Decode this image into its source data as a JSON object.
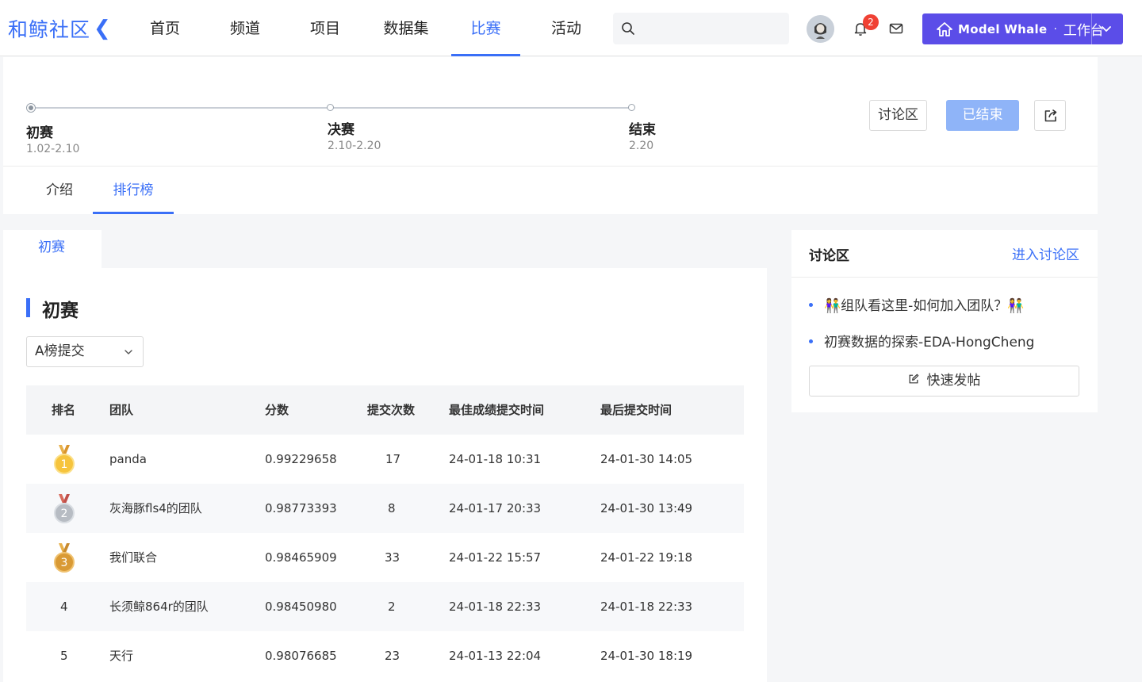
{
  "header": {
    "logo_text": "和鲸社区",
    "nav": [
      "首页",
      "频道",
      "项目",
      "数据集",
      "比赛",
      "活动"
    ],
    "active_nav": "比赛",
    "notification_count": "2",
    "workbench": {
      "brand": "Model Whale",
      "dot": "·",
      "label": "工作台"
    }
  },
  "stages": [
    {
      "name": "初赛",
      "date": "1.02-2.10"
    },
    {
      "name": "决赛",
      "date": "2.10-2.20"
    },
    {
      "name": "结束",
      "date": "2.20"
    }
  ],
  "actions": {
    "discuss": "讨论区",
    "ended": "已结束"
  },
  "subtabs": [
    "介绍",
    "排行榜"
  ],
  "active_subtab": "排行榜",
  "round_tab": "初赛",
  "section_title": "初赛",
  "select_value": "A榜提交",
  "table": {
    "headers": [
      "排名",
      "团队",
      "分数",
      "提交次数",
      "最佳成绩提交时间",
      "最后提交时间"
    ],
    "rows": [
      {
        "rank": "1",
        "team": "panda",
        "score": "0.99229658",
        "submits": "17",
        "best": "24-01-18 10:31",
        "last": "24-01-30 14:05",
        "medal": "gold"
      },
      {
        "rank": "2",
        "team": "灰海豚fls4的团队",
        "score": "0.98773393",
        "submits": "8",
        "best": "24-01-17 20:33",
        "last": "24-01-30 13:49",
        "medal": "silver"
      },
      {
        "rank": "3",
        "team": "我们联合",
        "score": "0.98465909",
        "submits": "33",
        "best": "24-01-22 15:57",
        "last": "24-01-22 19:18",
        "medal": "bronze"
      },
      {
        "rank": "4",
        "team": "长须鲸864r的团队",
        "score": "0.98450980",
        "submits": "2",
        "best": "24-01-18 22:33",
        "last": "24-01-18 22:33",
        "medal": ""
      },
      {
        "rank": "5",
        "team": "天行",
        "score": "0.98076685",
        "submits": "23",
        "best": "24-01-13 22:04",
        "last": "24-01-30 18:19",
        "medal": ""
      }
    ]
  },
  "side": {
    "title": "讨论区",
    "link": "进入讨论区",
    "items": [
      "👫组队看这里-如何加入团队？👫",
      "初赛数据的探索-EDA-HongCheng"
    ],
    "post_button": "快速发帖"
  },
  "colors": {
    "accent": "#3a6ff7",
    "brand_button": "#5b4de8",
    "ended_button": "#8fb4f8",
    "badge": "#f04134"
  }
}
